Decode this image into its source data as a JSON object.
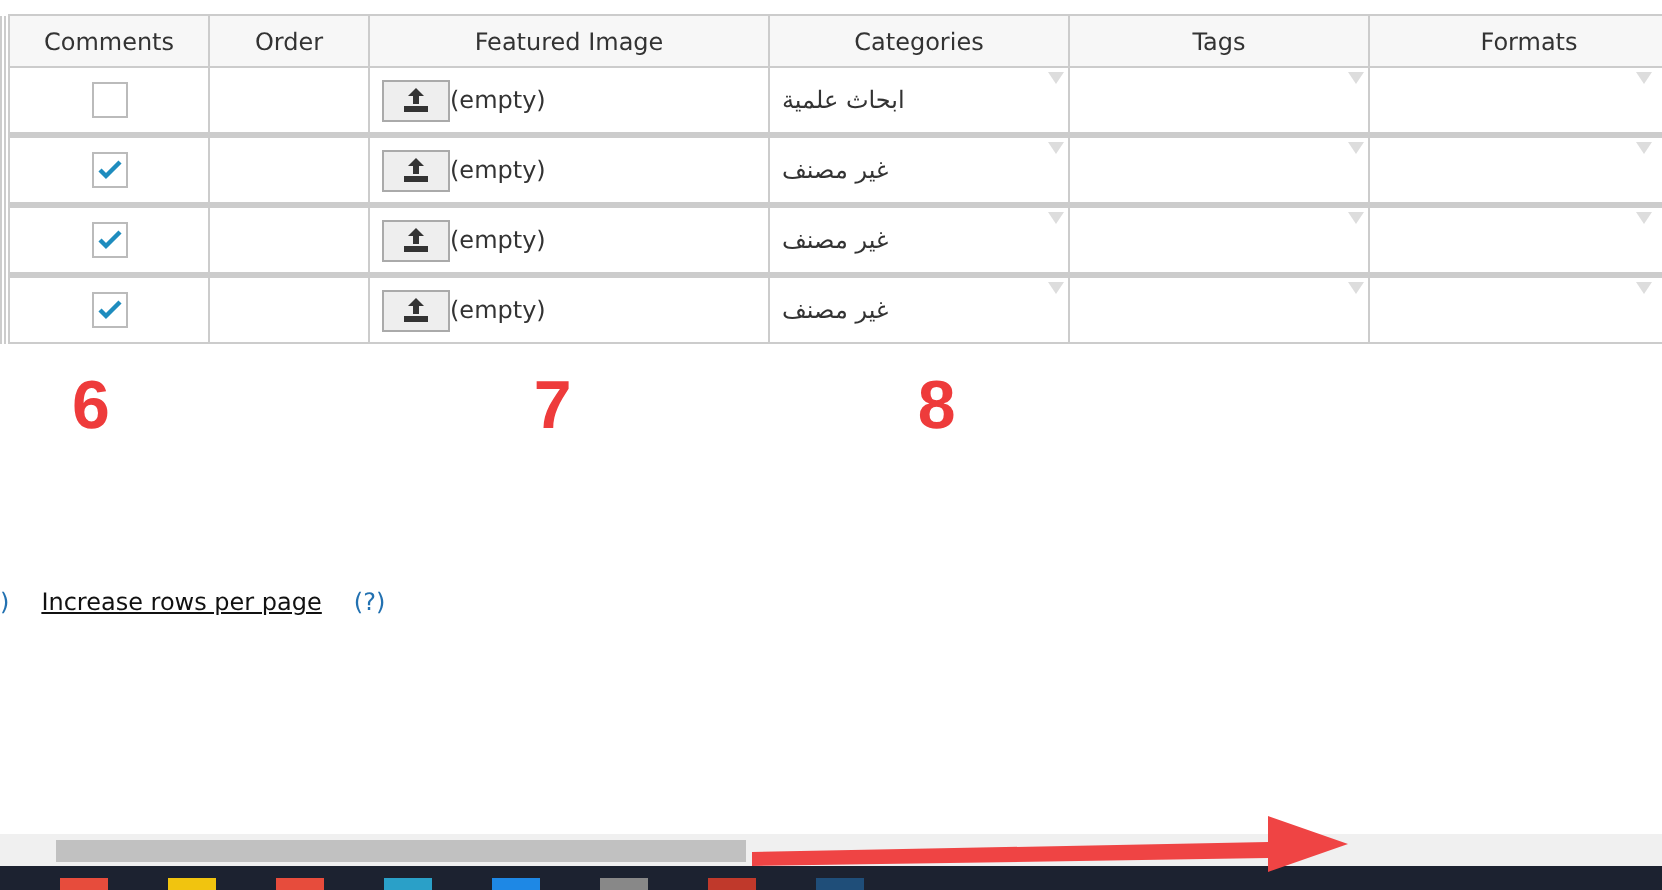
{
  "table": {
    "columns": [
      "Comments",
      "Order",
      "Featured Image",
      "Categories",
      "Tags",
      "Formats"
    ],
    "rows": [
      {
        "comments_checked": false,
        "image": "(empty)",
        "category": "ابحاث علمية"
      },
      {
        "comments_checked": true,
        "image": "(empty)",
        "category": "غير مصنف"
      },
      {
        "comments_checked": true,
        "image": "(empty)",
        "category": "غير مصنف"
      },
      {
        "comments_checked": true,
        "image": "(empty)",
        "category": "غير مصنف"
      }
    ]
  },
  "annotations": [
    "6",
    "7",
    "8"
  ],
  "footer": {
    "cut_help": ")",
    "link": "Increase rows per page",
    "help": "(?)"
  }
}
